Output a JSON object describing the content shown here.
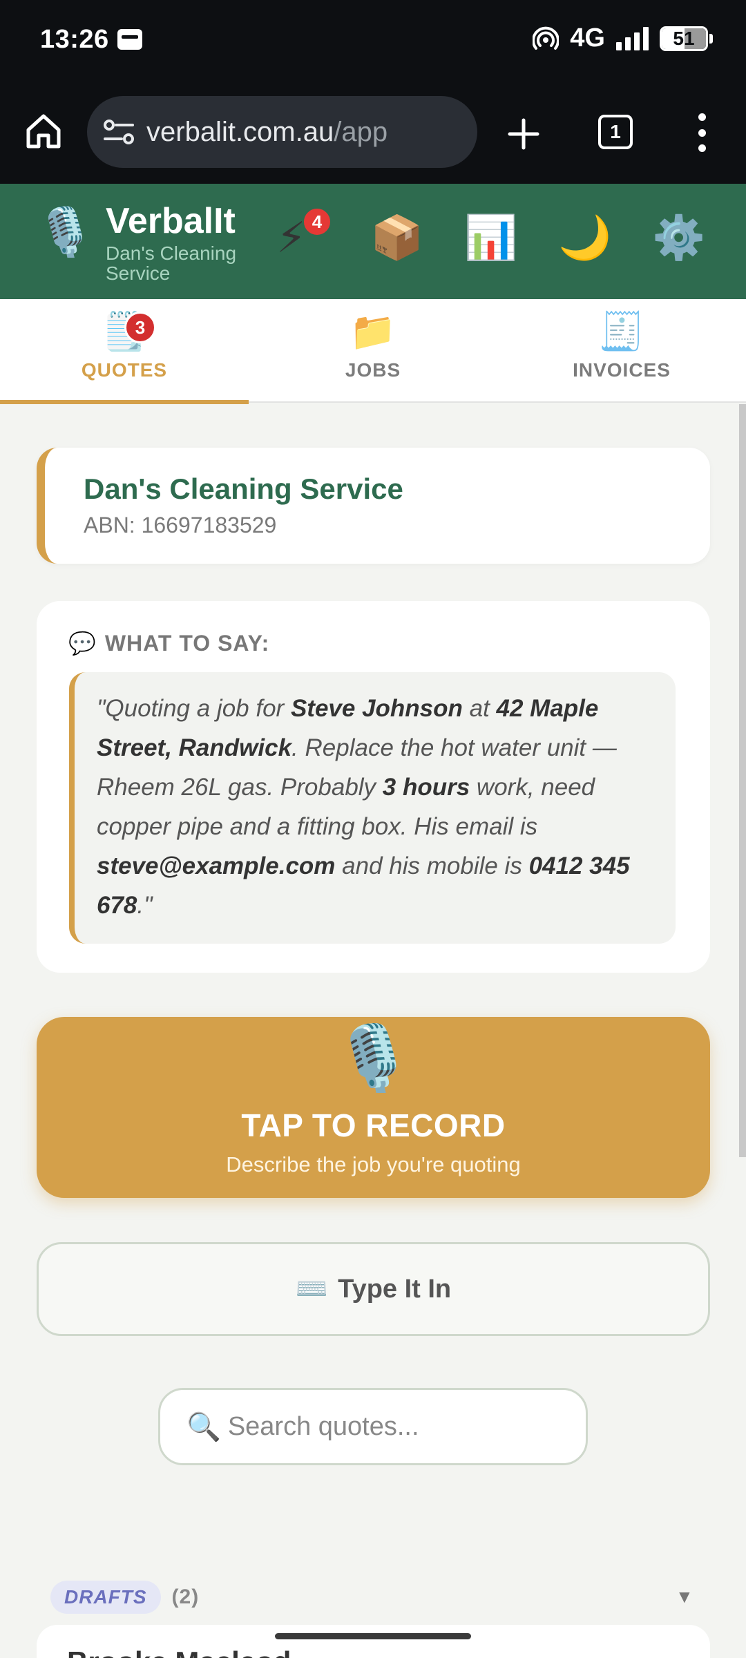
{
  "status_bar": {
    "time": "13:26",
    "network": "4G",
    "battery": "51"
  },
  "browser": {
    "url_host": "verbalit.com.au",
    "url_path": "/app",
    "tab_count": "1"
  },
  "header": {
    "logo_icon": "🎙️",
    "brand": "VerbalIt",
    "subtitle": "Dan's Cleaning Service",
    "icons": {
      "lightning": "⚡",
      "lightning_badge": "4",
      "box": "📦",
      "chart": "📊",
      "moon": "🌙",
      "gear": "⚙️"
    }
  },
  "tabs": [
    {
      "icon": "🗒️",
      "label": "QUOTES",
      "badge": "3",
      "active": true
    },
    {
      "icon": "📁",
      "label": "JOBS"
    },
    {
      "icon": "🧾",
      "label": "INVOICES"
    }
  ],
  "business": {
    "name": "Dan's Cleaning Service",
    "abn": "ABN: 16697183529"
  },
  "what_to_say": {
    "icon": "💬",
    "label": "WHAT TO SAY:",
    "quote_parts": [
      {
        "t": "\"Quoting a job for ",
        "b": false
      },
      {
        "t": "Steve Johnson",
        "b": true
      },
      {
        "t": " at ",
        "b": false
      },
      {
        "t": "42 Maple Street, Randwick",
        "b": true
      },
      {
        "t": ". Replace the hot water unit — Rheem 26L gas. Probably ",
        "b": false
      },
      {
        "t": "3 hours",
        "b": true
      },
      {
        "t": " work, need copper pipe and a fitting box. His email is ",
        "b": false
      },
      {
        "t": "steve@example.com",
        "b": true
      },
      {
        "t": " and his mobile is ",
        "b": false
      },
      {
        "t": "0412 345 678",
        "b": true
      },
      {
        "t": ".\"",
        "b": false
      }
    ]
  },
  "record": {
    "icon": "🎙️",
    "title": "TAP TO RECORD",
    "subtitle": "Describe the job you're quoting"
  },
  "type_in": {
    "icon": "⌨️",
    "label": "Type It In"
  },
  "search": {
    "icon": "🔍",
    "placeholder": "Search quotes..."
  },
  "drafts": {
    "label": "DRAFTS",
    "count": "(2)",
    "chevron": "▼",
    "first_item": "Brooke Macleod"
  },
  "colors": {
    "brand_green": "#2e6b4f",
    "accent_gold": "#d4a04a",
    "badge_red": "#d32f2f"
  }
}
